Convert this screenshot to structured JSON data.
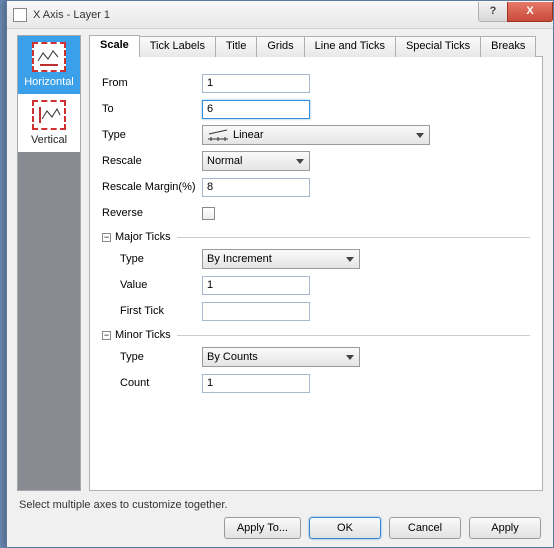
{
  "window": {
    "title": "X Axis - Layer 1",
    "help": "?",
    "close": "X"
  },
  "sidebar": {
    "items": [
      {
        "label": "Horizontal"
      },
      {
        "label": "Vertical"
      }
    ]
  },
  "tabs": [
    {
      "label": "Scale"
    },
    {
      "label": "Tick Labels"
    },
    {
      "label": "Title"
    },
    {
      "label": "Grids"
    },
    {
      "label": "Line and Ticks"
    },
    {
      "label": "Special Ticks"
    },
    {
      "label": "Breaks"
    }
  ],
  "scale": {
    "from_label": "From",
    "from_value": "1",
    "to_label": "To",
    "to_value": "6",
    "type_label": "Type",
    "type_value": "Linear",
    "rescale_label": "Rescale",
    "rescale_value": "Normal",
    "margin_label": "Rescale Margin(%)",
    "margin_value": "8",
    "reverse_label": "Reverse",
    "major": {
      "title": "Major Ticks",
      "type_label": "Type",
      "type_value": "By Increment",
      "value_label": "Value",
      "value_value": "1",
      "firsttick_label": "First Tick",
      "firsttick_value": ""
    },
    "minor": {
      "title": "Minor Ticks",
      "type_label": "Type",
      "type_value": "By Counts",
      "count_label": "Count",
      "count_value": "1"
    }
  },
  "footer": {
    "msg": "Select multiple axes to customize together.",
    "apply_to": "Apply To...",
    "ok": "OK",
    "cancel": "Cancel",
    "apply": "Apply"
  }
}
